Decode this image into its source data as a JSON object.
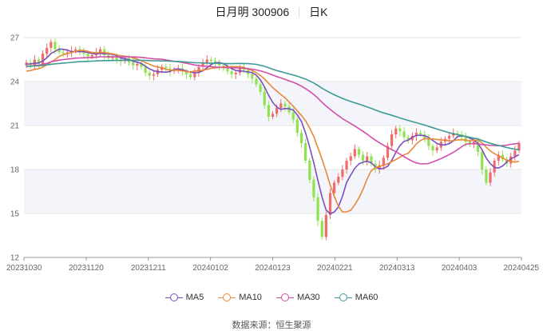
{
  "header": {
    "title": "日月明 300906",
    "period": "日K"
  },
  "source": "数据来源：恒生聚源",
  "chart_data": {
    "type": "candlestick",
    "ylim": [
      12,
      27
    ],
    "y_ticks": [
      12,
      15,
      18,
      21,
      24,
      27
    ],
    "x_tick_labels": [
      "20231030",
      "20231120",
      "20231211",
      "20240102",
      "20240123",
      "20240221",
      "20240313",
      "20240403",
      "20240425"
    ],
    "colors": {
      "up": "#f06b6b",
      "down": "#8ee34e",
      "band": "#f3f5fa",
      "grid": "#e6e6e6"
    },
    "closes": [
      25.3,
      25.1,
      25.5,
      25.2,
      25.9,
      26.3,
      26.7,
      26.2,
      26.0,
      25.9,
      26.0,
      26.1,
      26.2,
      26.0,
      25.9,
      25.7,
      25.8,
      26.0,
      26.2,
      25.8,
      25.6,
      25.7,
      25.5,
      25.4,
      25.6,
      25.3,
      25.1,
      25.2,
      25.0,
      24.6,
      24.4,
      24.5,
      24.8,
      25.0,
      24.9,
      24.7,
      24.8,
      24.9,
      24.7,
      24.5,
      24.3,
      24.6,
      25.0,
      25.3,
      25.5,
      25.4,
      25.2,
      25.1,
      24.9,
      24.7,
      24.5,
      24.6,
      24.9,
      24.8,
      24.5,
      24.2,
      23.8,
      23.3,
      22.4,
      21.6,
      21.8,
      22.2,
      22.5,
      22.3,
      21.9,
      21.4,
      20.5,
      19.8,
      18.6,
      17.3,
      16.1,
      14.5,
      13.4,
      14.9,
      16.4,
      17.1,
      17.5,
      18.0,
      18.6,
      18.9,
      19.4,
      19.0,
      18.6,
      18.9,
      18.4,
      18.0,
      18.3,
      18.8,
      19.6,
      20.4,
      20.8,
      20.6,
      20.2,
      20.0,
      20.3,
      20.5,
      20.4,
      20.1,
      19.6,
      19.3,
      19.5,
      19.9,
      20.1,
      20.3,
      20.5,
      20.4,
      20.2,
      19.9,
      19.7,
      19.9,
      19.2,
      18.0,
      17.1,
      17.8,
      18.6,
      19.0,
      18.7,
      18.4,
      18.9,
      19.3,
      19.8
    ],
    "series": [
      {
        "name": "MA5",
        "color": "#7b4fc0",
        "values": [
          25.19,
          25.2,
          25.25,
          25.27,
          25.4,
          25.62,
          25.92,
          26.06,
          26.22,
          26.2,
          26.14,
          26.04,
          26.04,
          26.04,
          26.04,
          25.98,
          25.92,
          25.88,
          25.92,
          25.9,
          25.88,
          25.86,
          25.76,
          25.6,
          25.56,
          25.5,
          25.38,
          25.32,
          25.24,
          25.04,
          24.86,
          24.74,
          24.66,
          24.66,
          24.64,
          24.68,
          24.84,
          24.86,
          24.8,
          24.72,
          24.64,
          24.6,
          24.62,
          24.74,
          24.94,
          25.16,
          25.28,
          25.3,
          25.22,
          25.06,
          24.88,
          24.76,
          24.72,
          24.7,
          24.66,
          24.6,
          24.44,
          24.12,
          23.64,
          23.06,
          22.58,
          22.26,
          22.1,
          22.16,
          22.14,
          22.06,
          21.72,
          21.28,
          20.5,
          19.52,
          18.46,
          17.26,
          16.14,
          15.24,
          14.98,
          15.1,
          15.46,
          16.18,
          17.12,
          17.62,
          18.08,
          18.38,
          18.5,
          18.56,
          18.46,
          18.18,
          18.04,
          18.08,
          18.22,
          18.62,
          19.18,
          19.64,
          19.92,
          20.0,
          20.2,
          20.32,
          20.34,
          20.3,
          20.18,
          19.98,
          19.78,
          19.68,
          19.68,
          19.76,
          19.96,
          20.24,
          20.3,
          20.26,
          20.14,
          20.02,
          19.78,
          19.34,
          18.78,
          18.4,
          18.14,
          18.1,
          18.24,
          18.5,
          18.72,
          18.86,
          19.02
        ]
      },
      {
        "name": "MA10",
        "color": "#e8883a",
        "values": [
          24.71,
          24.75,
          24.83,
          24.88,
          24.99,
          25.15,
          25.33,
          25.5,
          25.71,
          25.84,
          25.9,
          25.98,
          26.05,
          26.13,
          26.12,
          26.06,
          25.98,
          25.96,
          25.98,
          25.98,
          25.93,
          25.89,
          25.82,
          25.76,
          25.73,
          25.69,
          25.62,
          25.54,
          25.42,
          25.3,
          25.18,
          25.06,
          24.99,
          24.95,
          24.84,
          24.77,
          24.79,
          24.76,
          24.73,
          24.68,
          24.66,
          24.72,
          24.74,
          24.77,
          24.83,
          24.9,
          24.94,
          24.96,
          24.98,
          25.0,
          25.02,
          25.02,
          25.01,
          24.96,
          24.86,
          24.74,
          24.6,
          24.42,
          24.17,
          23.88,
          23.59,
          23.35,
          23.11,
          22.9,
          22.6,
          22.32,
          22.0,
          21.69,
          21.33,
          20.83,
          20.26,
          19.49,
          18.71,
          17.87,
          16.94,
          16.18,
          15.49,
          15.11,
          15.11,
          15.21,
          15.59,
          16.06,
          16.64,
          17.36,
          17.91,
          18.13,
          18.21,
          18.28,
          18.39,
          18.54,
          18.68,
          18.84,
          19.0,
          19.11,
          19.41,
          19.75,
          19.98,
          20.11,
          20.09,
          20.09,
          20.05,
          20.01,
          20.0,
          19.96,
          19.97,
          20.01,
          20.04,
          20.0,
          19.95,
          20.0,
          20.01,
          19.82,
          19.52,
          19.27,
          19.08,
          18.94,
          18.79,
          18.64,
          18.56,
          18.5,
          18.56
        ]
      },
      {
        "name": "MA30",
        "color": "#d24fa8",
        "values": [
          25.03,
          25.05,
          25.1,
          25.12,
          25.18,
          25.25,
          25.34,
          25.4,
          25.46,
          25.5,
          25.53,
          25.56,
          25.6,
          25.61,
          25.62,
          25.63,
          25.64,
          25.66,
          25.69,
          25.69,
          25.68,
          25.69,
          25.68,
          25.68,
          25.69,
          25.68,
          25.68,
          25.67,
          25.65,
          25.62,
          25.58,
          25.55,
          25.53,
          25.52,
          25.48,
          25.43,
          25.38,
          25.35,
          25.3,
          25.25,
          25.19,
          25.13,
          25.09,
          25.06,
          25.04,
          25.02,
          24.99,
          24.98,
          24.96,
          24.95,
          24.94,
          24.94,
          24.93,
          24.91,
          24.88,
          24.84,
          24.79,
          24.73,
          24.65,
          24.55,
          24.44,
          24.34,
          24.25,
          24.15,
          24.05,
          23.95,
          23.83,
          23.69,
          23.52,
          23.33,
          23.12,
          22.87,
          22.59,
          22.33,
          22.1,
          21.88,
          21.67,
          21.47,
          21.3,
          21.13,
          20.97,
          20.79,
          20.6,
          20.41,
          20.2,
          20.0,
          19.82,
          19.66,
          19.5,
          19.36,
          19.21,
          19.05,
          18.88,
          18.71,
          18.56,
          18.45,
          18.39,
          18.38,
          18.41,
          18.52,
          18.63,
          18.75,
          18.88,
          19.02,
          19.17,
          19.35,
          19.55,
          19.72,
          19.76,
          19.77,
          19.74,
          19.7,
          19.68,
          19.65,
          19.64,
          19.62,
          19.63,
          19.66,
          19.72,
          19.75,
          19.8
        ]
      },
      {
        "name": "MA60",
        "color": "#3f9a96",
        "values": [
          25.04,
          25.05,
          25.07,
          25.08,
          25.11,
          25.14,
          25.18,
          25.21,
          25.23,
          25.26,
          25.28,
          25.31,
          25.33,
          25.36,
          25.37,
          25.38,
          25.39,
          25.41,
          25.42,
          25.43,
          25.43,
          25.44,
          25.44,
          25.44,
          25.45,
          25.45,
          25.45,
          25.45,
          25.45,
          25.44,
          25.43,
          25.42,
          25.42,
          25.41,
          25.41,
          25.39,
          25.38,
          25.37,
          25.35,
          25.33,
          25.31,
          25.29,
          25.28,
          25.27,
          25.26,
          25.26,
          25.25,
          25.24,
          25.23,
          25.22,
          25.22,
          25.23,
          25.24,
          25.23,
          25.22,
          25.2,
          25.17,
          25.11,
          25.04,
          24.94,
          24.84,
          24.75,
          24.67,
          24.6,
          24.52,
          24.45,
          24.36,
          24.27,
          24.17,
          24.04,
          23.9,
          23.73,
          23.55,
          23.39,
          23.24,
          23.1,
          22.97,
          22.85,
          22.74,
          22.64,
          22.55,
          22.46,
          22.37,
          22.27,
          22.17,
          22.06,
          21.96,
          21.86,
          21.78,
          21.7,
          21.61,
          21.52,
          21.43,
          21.35,
          21.27,
          21.19,
          21.11,
          21.03,
          20.94,
          20.85,
          20.76,
          20.67,
          20.59,
          20.51,
          20.44,
          20.38,
          20.32,
          20.26,
          20.2,
          20.14,
          20.08,
          19.98,
          19.88,
          19.79,
          19.71,
          19.64,
          19.57,
          19.5,
          19.44,
          19.39,
          19.34
        ]
      }
    ]
  }
}
